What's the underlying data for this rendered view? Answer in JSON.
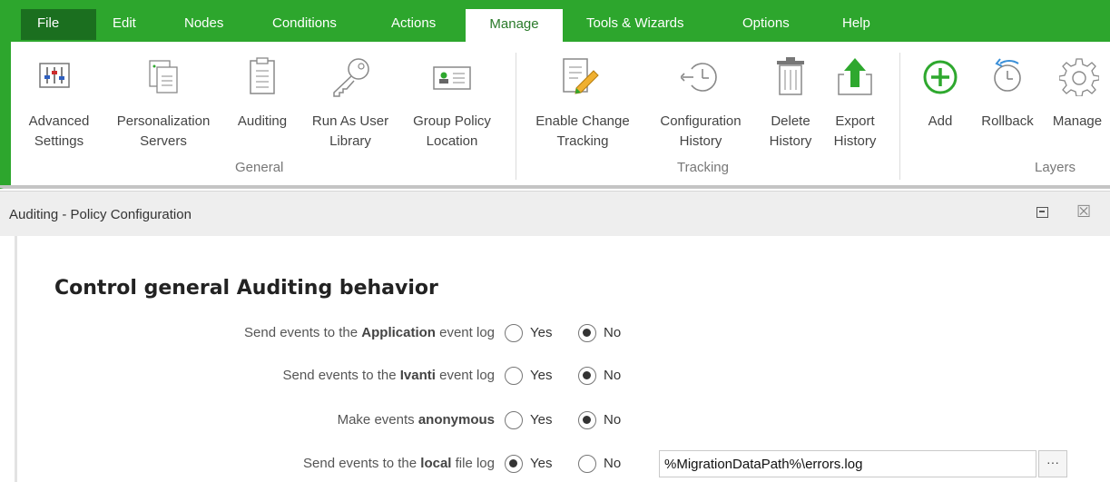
{
  "menu": {
    "items": [
      "File",
      "Edit",
      "Nodes",
      "Conditions",
      "Actions",
      "Manage",
      "Tools & Wizards",
      "Options",
      "Help"
    ]
  },
  "ribbon": {
    "buttons": [
      {
        "line1": "Advanced",
        "line2": "Settings",
        "icon": "sliders-icon"
      },
      {
        "line1": "Personalization",
        "line2": "Servers",
        "icon": "servers-icon"
      },
      {
        "line1": "Auditing",
        "line2": "",
        "icon": "clipboard-icon"
      },
      {
        "line1": "Run As User",
        "line2": "Library",
        "icon": "key-icon"
      },
      {
        "line1": "Group Policy",
        "line2": "Location",
        "icon": "id-card-icon"
      },
      {
        "line1": "Enable Change",
        "line2": "Tracking",
        "icon": "edit-document-icon"
      },
      {
        "line1": "Configuration",
        "line2": "History",
        "icon": "history-icon"
      },
      {
        "line1": "Delete",
        "line2": "History",
        "icon": "trash-icon"
      },
      {
        "line1": "Export",
        "line2": "History",
        "icon": "export-icon"
      },
      {
        "line1": "Add",
        "line2": "",
        "icon": "plus-circle-icon"
      },
      {
        "line1": "Rollback",
        "line2": "",
        "icon": "rollback-icon"
      },
      {
        "line1": "Manage",
        "line2": "",
        "icon": "gear-icon"
      }
    ],
    "groups": [
      "General",
      "Tracking",
      "Layers"
    ]
  },
  "panel": {
    "title": "Auditing - Policy Configuration",
    "heading": "Control general Auditing behavior",
    "rows": [
      {
        "pre": "Send events to the ",
        "bold": "Application",
        "post": " event log",
        "selected": "No"
      },
      {
        "pre": "Send events to the ",
        "bold": "Ivanti",
        "post": " event log",
        "selected": "No"
      },
      {
        "pre": "Make events ",
        "bold": "anonymous",
        "post": "",
        "selected": "No"
      },
      {
        "pre": "Send events to the ",
        "bold": "local",
        "post": " file log",
        "selected": "Yes"
      }
    ],
    "yes_label": "Yes",
    "no_label": "No",
    "log_path": "%MigrationDataPath%\\errors.log",
    "browse_label": "···"
  },
  "colors": {
    "accent": "#2da62d",
    "file_tab": "#1b6f1f",
    "icon_green": "#2ea82e"
  }
}
